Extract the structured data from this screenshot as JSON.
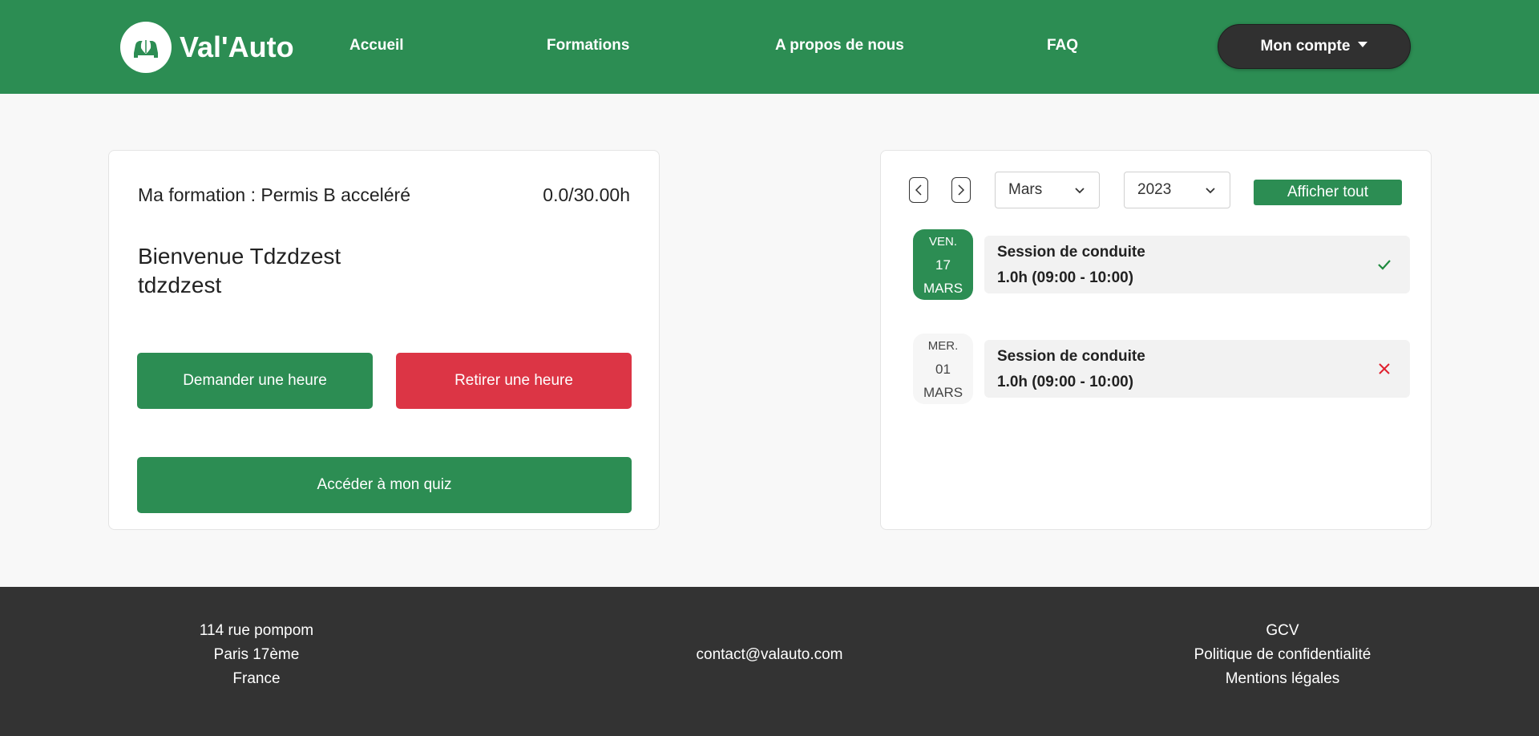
{
  "header": {
    "logo_text": "Val'Auto",
    "nav": [
      "Accueil",
      "Formations",
      "A propos de nous",
      "FAQ"
    ],
    "account_label": "Mon compte",
    "brand_color": "#2c8d53"
  },
  "formation": {
    "label": "Ma formation : Permis B acceléré",
    "hours": "0.0/30.00h",
    "welcome_line1": "Bienvenue Tdzdzest",
    "welcome_line2": "tdzdzest",
    "request_label": "Demander une heure",
    "remove_label": "Retirer une heure",
    "quiz_label": "Accéder à mon quiz"
  },
  "calendar": {
    "month": "Mars",
    "year": "2023",
    "show_all_label": "Afficher tout",
    "sessions": [
      {
        "dow": "VEN.",
        "day": "17",
        "month": "MARS",
        "title": "Session de conduite",
        "time": "1.0h (09:00 - 10:00)",
        "status": "check-icon"
      },
      {
        "dow": "MER.",
        "day": "01",
        "month": "MARS",
        "title": "Session de conduite",
        "time": "1.0h (09:00 - 10:00)",
        "status": "cross-icon"
      }
    ]
  },
  "footer": {
    "address": [
      "114 rue pompom",
      "Paris 17ème",
      "France"
    ],
    "email": "contact@valauto.com",
    "links": [
      "GCV",
      "Politique de confidentialité",
      "Mentions légales"
    ]
  }
}
